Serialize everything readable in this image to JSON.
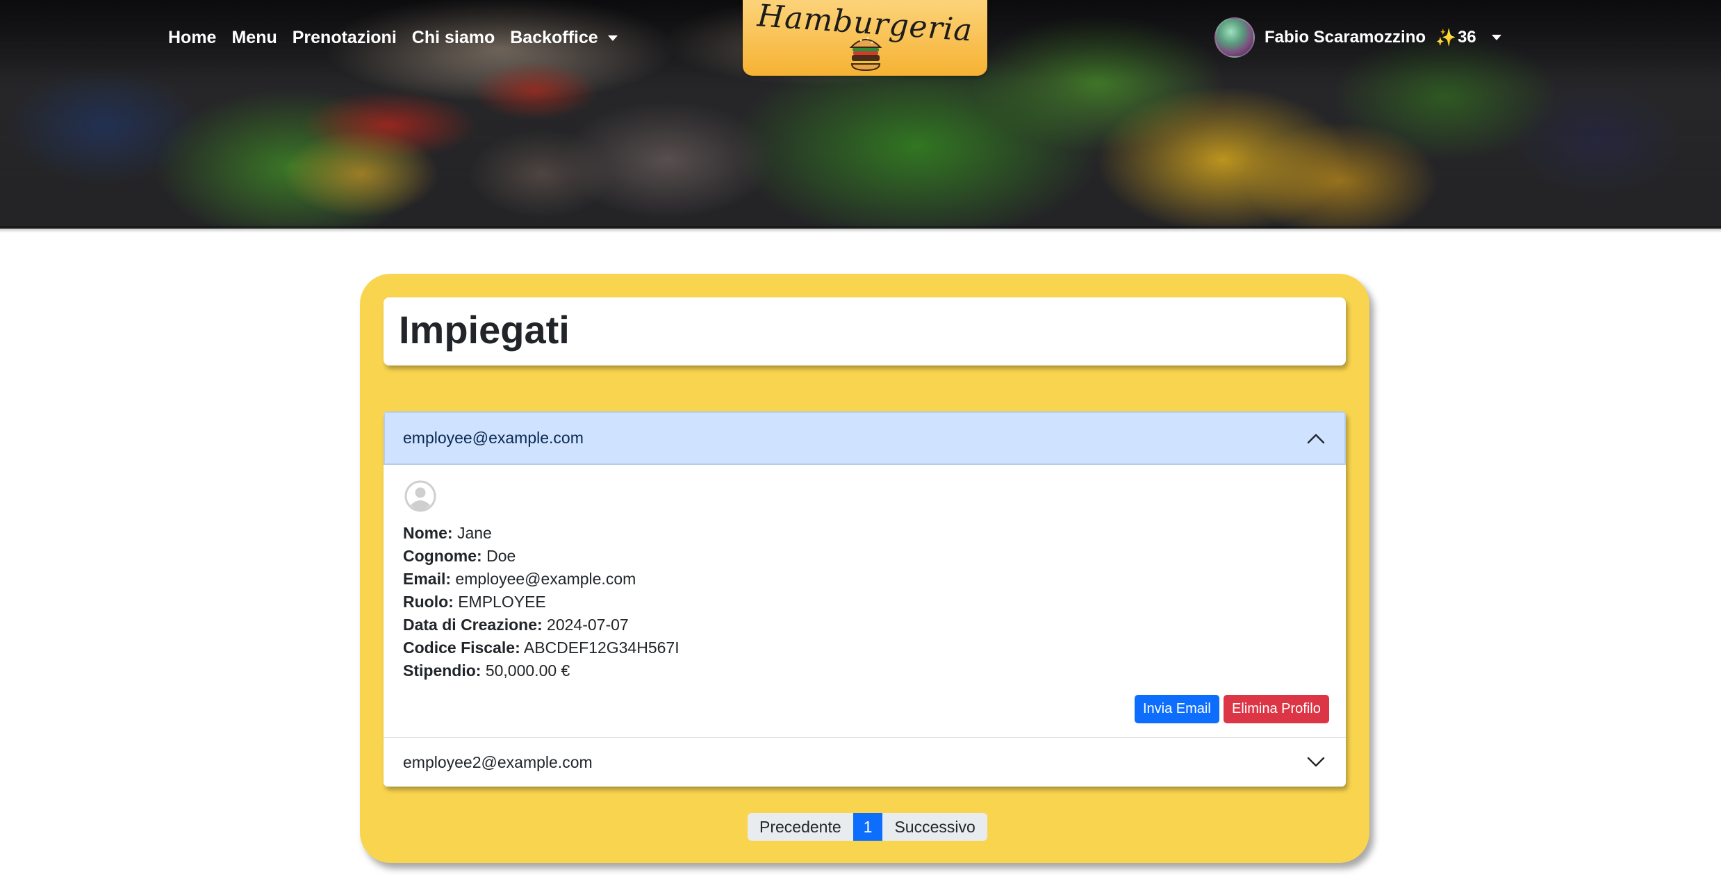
{
  "navbar": {
    "links": [
      "Home",
      "Menu",
      "Prenotazioni",
      "Chi siamo"
    ],
    "dropdown_label": "Backoffice",
    "logo_text": "Hamburgeria",
    "user": {
      "name": "Fabio Scaramozzino",
      "sparkle": "✨",
      "points": "36"
    }
  },
  "page": {
    "title": "Impiegati"
  },
  "employees": [
    {
      "email_header": "employee@example.com",
      "expanded": true,
      "fields": [
        {
          "label": "Nome:",
          "value": "Jane"
        },
        {
          "label": "Cognome:",
          "value": "Doe"
        },
        {
          "label": "Email:",
          "value": "employee@example.com"
        },
        {
          "label": "Ruolo:",
          "value": "EMPLOYEE"
        },
        {
          "label": "Data di Creazione:",
          "value": "2024-07-07"
        },
        {
          "label": "Codice Fiscale:",
          "value": "ABCDEF12G34H567I"
        },
        {
          "label": "Stipendio:",
          "value": "50,000.00 €"
        }
      ],
      "actions": {
        "send_email": "Invia Email",
        "delete_profile": "Elimina Profilo"
      }
    },
    {
      "email_header": "employee2@example.com",
      "expanded": false
    }
  ],
  "pagination": {
    "prev": "Precedente",
    "current": "1",
    "next": "Successivo"
  },
  "colors": {
    "panel": "#f9d54f",
    "primary": "#0d6efd",
    "danger": "#dc3545",
    "accordion_active": "#cfe2ff",
    "logo_gradient_top": "#fcd37a",
    "logo_gradient_bottom": "#f6b233"
  },
  "icons": [
    "chevron-up-icon",
    "chevron-down-icon",
    "person-circle-icon",
    "caret-down-icon",
    "burger-icon"
  ]
}
